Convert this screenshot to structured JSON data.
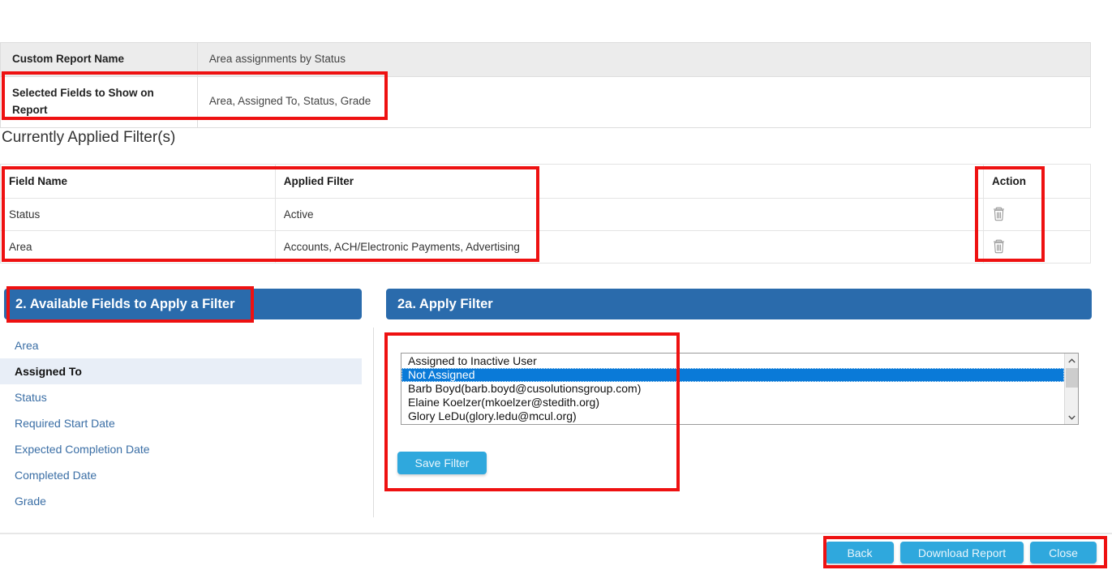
{
  "report_info": {
    "rows": [
      {
        "label": "Custom Report Name",
        "value": "Area assignments by Status"
      },
      {
        "label": "Selected Fields to Show on Report",
        "value": "Area, Assigned To, Status, Grade"
      }
    ]
  },
  "applied_filters": {
    "heading": "Currently Applied Filter(s)",
    "columns": [
      "Field Name",
      "Applied Filter",
      "",
      "Action"
    ],
    "rows": [
      {
        "field": "Status",
        "filter": "Active",
        "action_icon": "trash-icon"
      },
      {
        "field": "Area",
        "filter": "Accounts, ACH/Electronic Payments, Advertising",
        "action_icon": "trash-icon"
      }
    ]
  },
  "left_panel": {
    "title": "2. Available Fields to Apply a Filter",
    "fields": [
      {
        "label": "Area",
        "selected": false
      },
      {
        "label": "Assigned To",
        "selected": true
      },
      {
        "label": "Status",
        "selected": false
      },
      {
        "label": "Required Start Date",
        "selected": false
      },
      {
        "label": "Expected Completion Date",
        "selected": false
      },
      {
        "label": "Completed Date",
        "selected": false
      },
      {
        "label": "Grade",
        "selected": false
      }
    ]
  },
  "right_panel": {
    "title": "2a. Apply Filter",
    "listbox": {
      "options": [
        {
          "label": "Assigned to Inactive User",
          "selected": false
        },
        {
          "label": "Not Assigned",
          "selected": true
        },
        {
          "label": "Barb Boyd(barb.boyd@cusolutionsgroup.com)",
          "selected": false
        },
        {
          "label": "Elaine Koelzer(mkoelzer@stedith.org)",
          "selected": false
        },
        {
          "label": "Glory LeDu(glory.ledu@mcul.org)",
          "selected": false
        }
      ],
      "scrollbar": {
        "up_icon": "chevron-up-icon",
        "down_icon": "chevron-down-icon"
      }
    },
    "save_filter_label": "Save Filter"
  },
  "footer": {
    "back_label": "Back",
    "download_label": "Download Report",
    "close_label": "Close"
  },
  "colors": {
    "panel_header_blue": "#2a6bac",
    "button_blue": "#2fa8dd",
    "selection_blue": "#0a7ad8",
    "annotation_red": "#ee1111",
    "link_blue": "#3a6ea5",
    "table_header_gray": "#ececec"
  }
}
